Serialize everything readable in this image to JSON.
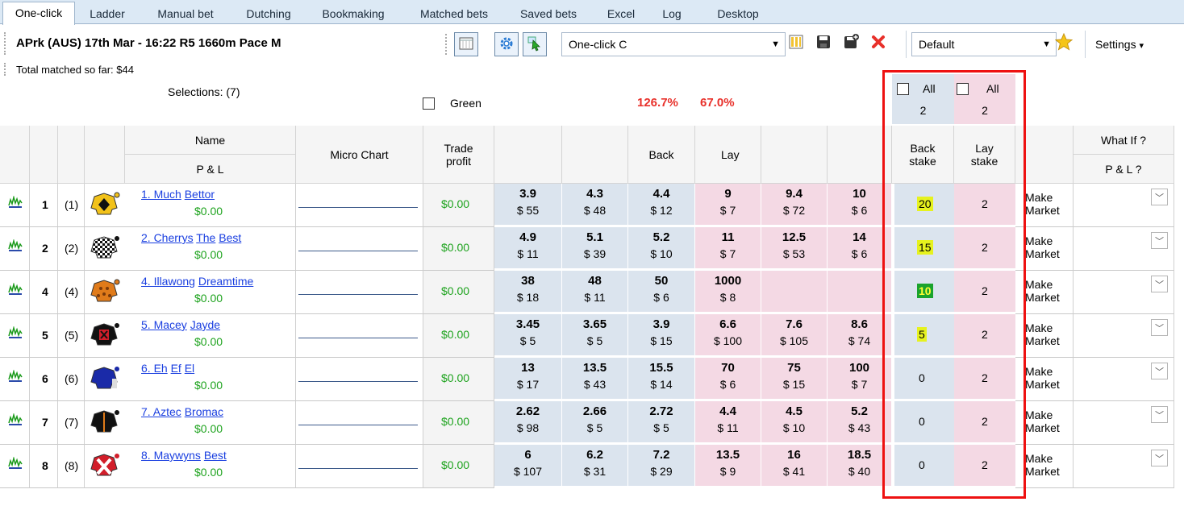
{
  "tabs": [
    {
      "label": "One-click",
      "active": true
    },
    {
      "label": "Ladder"
    },
    {
      "label": "Manual bet"
    },
    {
      "label": "Dutching"
    },
    {
      "label": "Bookmaking"
    },
    {
      "label": "Matched bets"
    },
    {
      "label": "Saved bets"
    },
    {
      "label": "Excel"
    },
    {
      "label": "Log"
    },
    {
      "label": "Desktop"
    }
  ],
  "race_title": "APrk (AUS) 17th Mar - 16:22 R5 1660m Pace M",
  "total_matched": "Total matched so far: $44",
  "selections_label": "Selections: (7)",
  "green_label": "Green",
  "back_book_pct": "126.7%",
  "lay_book_pct": "67.0%",
  "profile_select": "One-click C",
  "layout_select": "Default",
  "settings_label": "Settings",
  "settings_caret": "▾",
  "all_back": {
    "label": "All",
    "value": "2"
  },
  "all_lay": {
    "label": "All",
    "value": "2"
  },
  "columns": {
    "name": "Name",
    "pl": "P & L",
    "micro_chart": "Micro Chart",
    "trade_profit": "Trade profit",
    "back": "Back",
    "lay": "Lay",
    "back_stake": "Back stake",
    "lay_stake": "Lay stake",
    "what_if": "What If ?",
    "pl_q": "P & L ?"
  },
  "make_market_label": "Make Market",
  "icons": [
    "chart-icon",
    "grid-icon",
    "gear-icon",
    "cursor-icon",
    "columns-icon",
    "save-icon",
    "save-as-icon",
    "delete-icon",
    "star-icon",
    "jockey-silk-icon"
  ],
  "colors": {
    "back": "#dbe4ee",
    "lay": "#f4d9e4",
    "profit": "#1ea31e",
    "pct": "#e8302a",
    "highlight": "#e6f21e",
    "redbox": "#ee1111"
  },
  "runners": [
    {
      "num": "1",
      "draw": "(1)",
      "name_a": "1. Much",
      "name_b": "Bettor",
      "pl": "$0.00",
      "trade": "$0.00",
      "prices": [
        [
          "3.9",
          "$ 55"
        ],
        [
          "4.3",
          "$ 48"
        ],
        [
          "4.4",
          "$ 12"
        ],
        [
          "9",
          "$ 7"
        ],
        [
          "9.4",
          "$ 72"
        ],
        [
          "10",
          "$ 6"
        ]
      ],
      "back_stake": "20",
      "lay_stake": "2",
      "silk": "silk1"
    },
    {
      "num": "2",
      "draw": "(2)",
      "name_a": "2. Cherrys",
      "name_b": "The",
      "name_c": "Best",
      "pl": "$0.00",
      "trade": "$0.00",
      "prices": [
        [
          "4.9",
          "$ 11"
        ],
        [
          "5.1",
          "$ 39"
        ],
        [
          "5.2",
          "$ 10"
        ],
        [
          "11",
          "$ 7"
        ],
        [
          "12.5",
          "$ 53"
        ],
        [
          "14",
          "$ 6"
        ]
      ],
      "back_stake": "15",
      "lay_stake": "2",
      "silk": "silk2"
    },
    {
      "num": "4",
      "draw": "(4)",
      "name_a": "4. Illawong",
      "name_b": "Dreamtime",
      "pl": "$0.00",
      "trade": "$0.00",
      "prices": [
        [
          "38",
          "$ 18"
        ],
        [
          "48",
          "$ 11"
        ],
        [
          "50",
          "$ 6"
        ],
        [
          "1000",
          "$ 8"
        ],
        [
          "",
          ""
        ],
        [
          "",
          ""
        ]
      ],
      "back_stake": "10",
      "lay_stake": "2",
      "silk": "silk3"
    },
    {
      "num": "5",
      "draw": "(5)",
      "name_a": "5. Macey",
      "name_b": "Jayde",
      "pl": "$0.00",
      "trade": "$0.00",
      "prices": [
        [
          "3.45",
          "$ 5"
        ],
        [
          "3.65",
          "$ 5"
        ],
        [
          "3.9",
          "$ 15"
        ],
        [
          "6.6",
          "$ 100"
        ],
        [
          "7.6",
          "$ 105"
        ],
        [
          "8.6",
          "$ 74"
        ]
      ],
      "back_stake": "5",
      "lay_stake": "2",
      "silk": "silk4"
    },
    {
      "num": "6",
      "draw": "(6)",
      "name_a": "6. Eh",
      "name_b": "Ef",
      "name_c": "El",
      "pl": "$0.00",
      "trade": "$0.00",
      "prices": [
        [
          "13",
          "$ 17"
        ],
        [
          "13.5",
          "$ 43"
        ],
        [
          "15.5",
          "$ 14"
        ],
        [
          "70",
          "$ 6"
        ],
        [
          "75",
          "$ 15"
        ],
        [
          "100",
          "$ 7"
        ]
      ],
      "back_stake": "0",
      "lay_stake": "2",
      "silk": "silk5"
    },
    {
      "num": "7",
      "draw": "(7)",
      "name_a": "7. Aztec",
      "name_b": "Bromac",
      "pl": "$0.00",
      "trade": "$0.00",
      "prices": [
        [
          "2.62",
          "$ 98"
        ],
        [
          "2.66",
          "$ 5"
        ],
        [
          "2.72",
          "$ 5"
        ],
        [
          "4.4",
          "$ 11"
        ],
        [
          "4.5",
          "$ 10"
        ],
        [
          "5.2",
          "$ 43"
        ]
      ],
      "back_stake": "0",
      "lay_stake": "2",
      "silk": "silk6"
    },
    {
      "num": "8",
      "draw": "(8)",
      "name_a": "8. Maywyns",
      "name_b": "Best",
      "pl": "$0.00",
      "trade": "$0.00",
      "prices": [
        [
          "6",
          "$ 107"
        ],
        [
          "6.2",
          "$ 31"
        ],
        [
          "7.2",
          "$ 29"
        ],
        [
          "13.5",
          "$ 9"
        ],
        [
          "16",
          "$ 41"
        ],
        [
          "18.5",
          "$ 40"
        ]
      ],
      "back_stake": "0",
      "lay_stake": "2",
      "silk": "silk7"
    }
  ]
}
